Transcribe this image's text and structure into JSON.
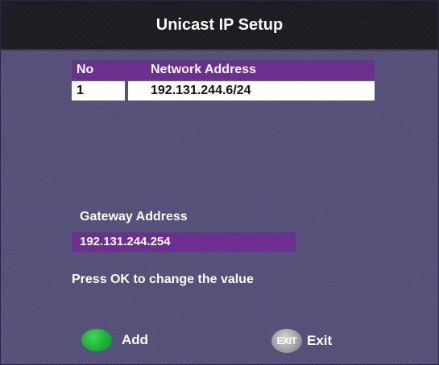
{
  "title": "Unicast IP Setup",
  "table": {
    "headers": [
      "No",
      "Network Address"
    ],
    "rows": [
      {
        "no": "1",
        "address": "192.131.244.6/24"
      }
    ]
  },
  "gateway": {
    "label": "Gateway Address",
    "value": "192.131.244.254"
  },
  "hint": "Press OK to change the value",
  "footer": {
    "add_label": "Add",
    "exit_icon_text": "EXIT",
    "exit_label": "Exit"
  },
  "colors": {
    "background": "#55507a",
    "titlebar": "#1b1a1f",
    "accent_purple": "#6b2f8e",
    "add_green": "#13a72e"
  },
  "icons": [
    "green-button-icon",
    "exit-button-icon"
  ]
}
